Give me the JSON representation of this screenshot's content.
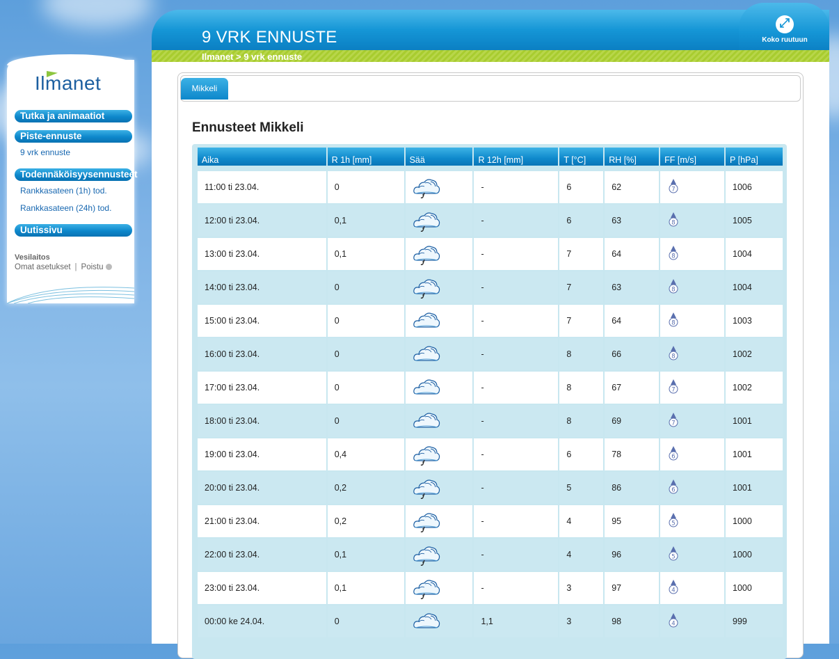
{
  "sidebar": {
    "logo": "Ilmanet",
    "nav": {
      "animations": "Tutka ja animaatiot",
      "point_forecast": "Piste-ennuste",
      "forecast_9day": "9 vrk ennuste",
      "probability": "Todennäköisyysennusteet",
      "heavy_rain_1h": "Rankkasateen (1h) tod.",
      "heavy_rain_24h": "Rankkasateen (24h) tod.",
      "news": "Uutissivu"
    },
    "org": "Vesilaitos",
    "own_settings": "Omat asetukset",
    "separator": "|",
    "logout": "Poistu"
  },
  "header": {
    "title": "9 VRK ENNUSTE",
    "fullscreen": "Koko ruutuun",
    "breadcrumb": "Ilmanet > 9 vrk ennuste"
  },
  "main": {
    "tab": "Mikkeli",
    "section_title": "Ennusteet Mikkeli",
    "columns": [
      "Aika",
      "R 1h [mm]",
      "Sää",
      "R 12h [mm]",
      "T [°C]",
      "RH [%]",
      "FF [m/s]",
      "P [hPa]"
    ],
    "rows": [
      {
        "time": "11:00 ti 23.04.",
        "r1h": "0",
        "icon": "cloud-drizzle-icon",
        "r12h": "-",
        "t": "6",
        "rh": "62",
        "ff": "7",
        "p": "1006"
      },
      {
        "time": "12:00 ti 23.04.",
        "r1h": "0,1",
        "icon": "cloud-drizzle-icon",
        "r12h": "-",
        "t": "6",
        "rh": "63",
        "ff": "8",
        "p": "1005"
      },
      {
        "time": "13:00 ti 23.04.",
        "r1h": "0,1",
        "icon": "cloud-drizzle-icon",
        "r12h": "-",
        "t": "7",
        "rh": "64",
        "ff": "8",
        "p": "1004"
      },
      {
        "time": "14:00 ti 23.04.",
        "r1h": "0",
        "icon": "cloud-drizzle-icon",
        "r12h": "-",
        "t": "7",
        "rh": "63",
        "ff": "8",
        "p": "1004"
      },
      {
        "time": "15:00 ti 23.04.",
        "r1h": "0",
        "icon": "cloud-icon",
        "r12h": "-",
        "t": "7",
        "rh": "64",
        "ff": "8",
        "p": "1003"
      },
      {
        "time": "16:00 ti 23.04.",
        "r1h": "0",
        "icon": "cloud-icon",
        "r12h": "-",
        "t": "8",
        "rh": "66",
        "ff": "8",
        "p": "1002"
      },
      {
        "time": "17:00 ti 23.04.",
        "r1h": "0",
        "icon": "cloud-icon",
        "r12h": "-",
        "t": "8",
        "rh": "67",
        "ff": "7",
        "p": "1002"
      },
      {
        "time": "18:00 ti 23.04.",
        "r1h": "0",
        "icon": "cloud-icon",
        "r12h": "-",
        "t": "8",
        "rh": "69",
        "ff": "7",
        "p": "1001"
      },
      {
        "time": "19:00 ti 23.04.",
        "r1h": "0,4",
        "icon": "cloud-drizzle-icon",
        "r12h": "-",
        "t": "6",
        "rh": "78",
        "ff": "6",
        "p": "1001"
      },
      {
        "time": "20:00 ti 23.04.",
        "r1h": "0,2",
        "icon": "cloud-drizzle-icon",
        "r12h": "-",
        "t": "5",
        "rh": "86",
        "ff": "6",
        "p": "1001"
      },
      {
        "time": "21:00 ti 23.04.",
        "r1h": "0,2",
        "icon": "cloud-drizzle-icon",
        "r12h": "-",
        "t": "4",
        "rh": "95",
        "ff": "5",
        "p": "1000"
      },
      {
        "time": "22:00 ti 23.04.",
        "r1h": "0,1",
        "icon": "cloud-drizzle-icon",
        "r12h": "-",
        "t": "4",
        "rh": "96",
        "ff": "5",
        "p": "1000"
      },
      {
        "time": "23:00 ti 23.04.",
        "r1h": "0,1",
        "icon": "cloud-drizzle-icon",
        "r12h": "-",
        "t": "3",
        "rh": "97",
        "ff": "4",
        "p": "1000"
      },
      {
        "time": "00:00 ke 24.04.",
        "r1h": "0",
        "icon": "cloud-icon",
        "r12h": "1,1",
        "t": "3",
        "rh": "98",
        "ff": "4",
        "p": "999"
      }
    ]
  }
}
